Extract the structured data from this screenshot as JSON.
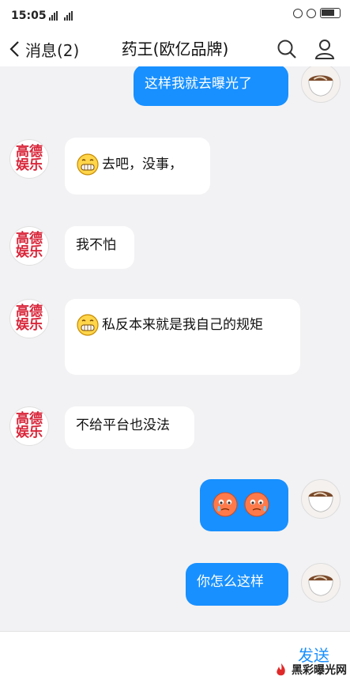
{
  "status_bar": {
    "time": "15:05",
    "net1": "4G",
    "net2": "2G"
  },
  "header": {
    "back_label": "消息(2)",
    "title": "药王(欧亿品牌)"
  },
  "brand_avatar": {
    "line1": "高德",
    "line2": "娱乐"
  },
  "messages": [
    {
      "side": "out",
      "text": "这样我就去曝光了"
    },
    {
      "side": "in",
      "emoji": "grin-icon",
      "text": "去吧，没事，"
    },
    {
      "side": "in",
      "text": "我不怕"
    },
    {
      "side": "in",
      "emoji": "grin-icon",
      "text": "私反本来就是我自己的规矩"
    },
    {
      "side": "in",
      "text": "不给平台也没法"
    },
    {
      "side": "out",
      "emoji": "crying-faces-icon",
      "text": ""
    },
    {
      "side": "out",
      "text": "你怎么这样"
    }
  ],
  "input": {
    "send_label": "发送"
  },
  "watermark": {
    "text": "黑彩曝光网"
  },
  "colors": {
    "outgoing_bubble": "#1890ff",
    "incoming_bubble": "#ffffff",
    "background": "#f2f2f4",
    "accent": "#1a8fff"
  }
}
